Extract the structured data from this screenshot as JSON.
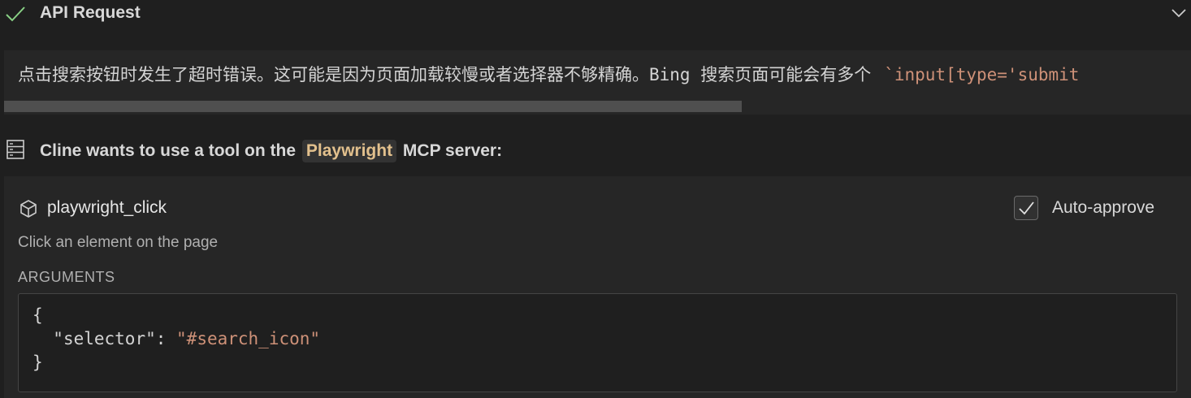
{
  "api_request": {
    "title": "API Request",
    "status_icon": "check-icon",
    "toggle_icon": "chevron-down-icon"
  },
  "message": {
    "text": "点击搜索按钮时发生了超时错误。这可能是因为页面加载较慢或者选择器不够精确。Bing 搜索页面可能会有多个",
    "code_snippet": "`input[type='submit"
  },
  "tool_request": {
    "prefix": "Cline wants to use a tool on the",
    "server_name": "Playwright",
    "suffix": "MCP server:",
    "icon": "server-icon"
  },
  "tool": {
    "name": "playwright_click",
    "icon": "cube-icon",
    "description": "Click an element on the page",
    "auto_approve_label": "Auto-approve",
    "auto_approve_checked": true,
    "arguments_label": "ARGUMENTS",
    "arguments": {
      "open": "{",
      "key": "\"selector\"",
      "colon": ": ",
      "value": "\"#search_icon\"",
      "close": "}"
    }
  },
  "colors": {
    "background": "#1f1f1f",
    "panel": "#262626",
    "success_check": "#89d185",
    "string": "#ce9178",
    "server_chip": "#e2c08d"
  }
}
